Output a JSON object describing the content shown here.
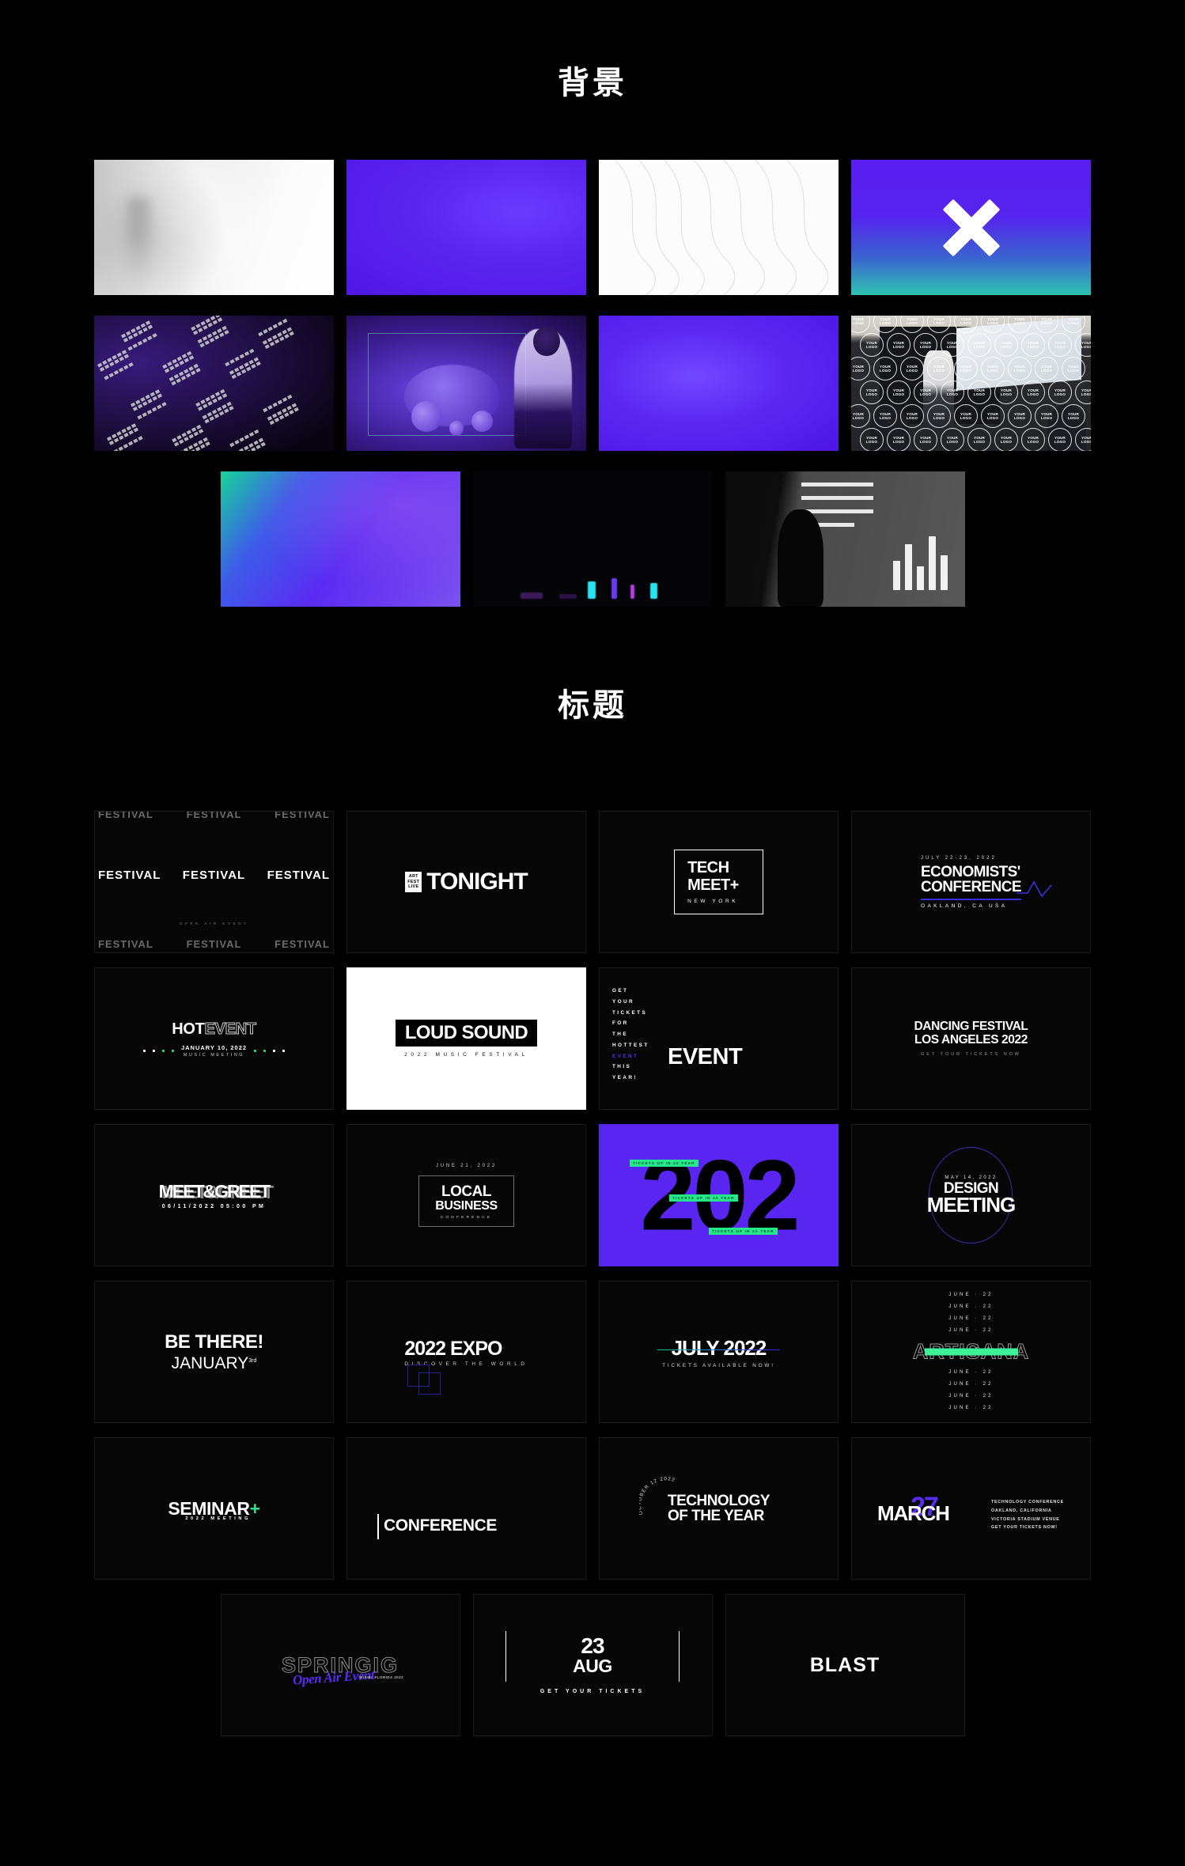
{
  "sections": {
    "backgrounds": {
      "heading": "背景"
    },
    "titles": {
      "heading": "标题"
    }
  },
  "colors": {
    "page_background": "#000000",
    "accent_violet": "#5826f0",
    "accent_green": "#24e98a",
    "accent_teal": "#2fc3b0",
    "text_primary": "#ffffff"
  },
  "backgrounds": [
    {
      "name": "white-blurred-corridor",
      "style": "photo",
      "label": ""
    },
    {
      "name": "violet-gradient-1",
      "style": "gradient",
      "label": ""
    },
    {
      "name": "white-contour-waves",
      "style": "vector",
      "label": ""
    },
    {
      "name": "violet-teal-gradient-x",
      "style": "gradient",
      "label": "",
      "glyph": "X"
    },
    {
      "name": "dark-diagonal-tile-pattern",
      "style": "pattern",
      "label": ""
    },
    {
      "name": "purple-presenter-photo",
      "style": "photo",
      "label": ""
    },
    {
      "name": "violet-gradient-2",
      "style": "gradient",
      "label": ""
    },
    {
      "name": "conference-audience-photo",
      "style": "photo",
      "label": "YOUR LOGO"
    },
    {
      "name": "aurora-green-violet-gradient",
      "style": "gradient",
      "label": ""
    },
    {
      "name": "dark-neon-stage-photo",
      "style": "photo",
      "label": ""
    },
    {
      "name": "bw-projection-silhouette-photo",
      "style": "photo",
      "label": ""
    }
  ],
  "titles": [
    {
      "name": "festival-repeat",
      "repeat_word": "FESTIVAL",
      "sub": "OPEN AIR EVENT"
    },
    {
      "name": "tonight",
      "badge_lines": [
        "ART",
        "FEST",
        "LIVE"
      ],
      "word": "TONIGHT"
    },
    {
      "name": "tech-meet",
      "line1": "TECH",
      "line2": "MEET+",
      "sub": "NEW YORK"
    },
    {
      "name": "economists-conference",
      "kicker": "JULY 22-23, 2022",
      "line1": "ECONOMISTS'",
      "line2": "CONFERENCE",
      "sub": "OAKLAND, CA USA"
    },
    {
      "name": "hot-event",
      "word1": "HOT",
      "word2": "EVENT",
      "date": "JANUARY 10, 2022",
      "sub": "MUSIC MEETING"
    },
    {
      "name": "loud-sound",
      "word": "LOUD SOUND",
      "sub": "2022 MUSIC FESTIVAL"
    },
    {
      "name": "event-tickets",
      "stack": [
        "GET",
        "YOUR",
        "TICKETS",
        "FOR",
        "THE",
        "HOTTEST",
        "EVENT",
        "THIS",
        "YEAR!"
      ],
      "accent_index": 6,
      "word": "EVENT"
    },
    {
      "name": "dancing-festival",
      "line1": "DANCING FESTIVAL",
      "line2": "LOS ANGELES 2022",
      "sub": "GET YOUR TICKETS NOW"
    },
    {
      "name": "meet-and-greet",
      "word": "MEET&GREET",
      "sub": "06/11/2022  05:00  PM"
    },
    {
      "name": "local-business",
      "date": "JUNE 21, 2022",
      "line1": "LOCAL",
      "line2": "BUSINESS",
      "sub": "CONFERENCE"
    },
    {
      "name": "year-2022",
      "digits": "202",
      "tags": [
        "TICKETS UP IN 22 YEAR",
        "TICKETS UP IN 22 YEAR",
        "TICKETS UP IN 22 YEAR"
      ]
    },
    {
      "name": "design-meeting",
      "date": "MAY 14, 2022",
      "line1": "DESIGN",
      "line2": "MEETING"
    },
    {
      "name": "be-there",
      "line1": "BE THERE!",
      "line2": "JANUARY",
      "suffix": "3rd"
    },
    {
      "name": "expo-2022",
      "line1": "2022 EXPO",
      "sub": "DISCOVER THE WORLD"
    },
    {
      "name": "july-2022",
      "line1": "JULY 2022",
      "sub": "TICKETS AVAILABLE NOW!"
    },
    {
      "name": "artisana",
      "word": "ARTISANA",
      "repeat_line": "JUNE · 22",
      "repeat_count": 8
    },
    {
      "name": "seminar-plus",
      "word": "SEMINAR",
      "plus": "+",
      "sub": "2022 MEETING"
    },
    {
      "name": "conference",
      "word": "CONFERENCE"
    },
    {
      "name": "technology-of-the-year",
      "arc": "OCTOBER 12 2022",
      "line1": "TECHNOLOGY",
      "line2": "OF THE YEAR"
    },
    {
      "name": "march-27",
      "word": "MARCH",
      "day": "27",
      "meta": [
        "TECHNOLOGY CONFERENCE",
        "OAKLAND, CALIFORNIA",
        "VICTORIA STADIUM VENUE",
        "GET YOUR TICKETS NOW!"
      ]
    },
    {
      "name": "springig",
      "word": "SPRINGIG",
      "script": "Open Air Event",
      "meta": "MIAMI, FLORIDA 2022"
    },
    {
      "name": "aug-23",
      "day": "23",
      "month": "AUG",
      "sub": "GET YOUR TICKETS"
    },
    {
      "name": "blast",
      "word": "BLAST"
    }
  ]
}
